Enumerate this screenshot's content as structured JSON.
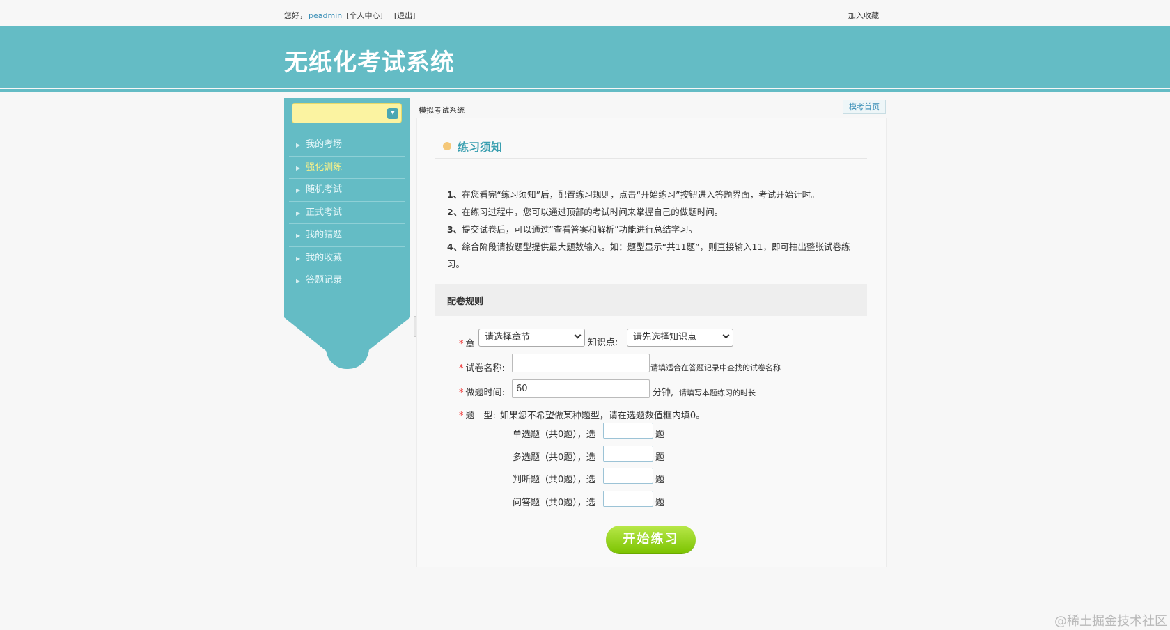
{
  "topbar": {
    "greeting": "您好，",
    "username": "peadmin",
    "profile_link": "[个人中心]",
    "logout_link": "[退出]",
    "bookmark": "加入收藏"
  },
  "header": {
    "title": "无纸化考试系统"
  },
  "sidebar": {
    "select_value": "",
    "items": [
      {
        "label": "我的考场",
        "active": false
      },
      {
        "label": "强化训练",
        "active": true
      },
      {
        "label": "随机考试",
        "active": false
      },
      {
        "label": "正式考试",
        "active": false
      },
      {
        "label": "我的错题",
        "active": false
      },
      {
        "label": "我的收藏",
        "active": false
      },
      {
        "label": "答题记录",
        "active": false
      }
    ]
  },
  "breadcrumb": "模拟考试系统",
  "home_button": "模考首页",
  "notice": {
    "title": "练习须知",
    "rules": [
      {
        "num": "1、",
        "text": "在您看完“练习须知”后，配置练习规则，点击“开始练习”按钮进入答题界面，考试开始计时。"
      },
      {
        "num": "2、",
        "text": "在练习过程中，您可以通过顶部的考试时间来掌握自己的做题时间。"
      },
      {
        "num": "3、",
        "text": "提交试卷后，可以通过“查看答案和解析”功能进行总结学习。"
      },
      {
        "num": "4、",
        "text": "综合阶段请按题型提供最大题数输入。如：题型显示“共11题”，则直接输入11，即可抽出整张试卷练习。"
      }
    ]
  },
  "config": {
    "title": "配卷规则",
    "chapter_label": "章",
    "chapter_select": "请选择章节",
    "knowledge_label": "知识点:",
    "knowledge_select": "请先选择知识点",
    "paper_name_label": "试卷名称:",
    "paper_name_value": "",
    "paper_name_hint": "请填适合在答题记录中查找的试卷名称",
    "time_label": "做题时间:",
    "time_value": "60",
    "time_unit": "分钟,",
    "time_hint": "请填写本题练习的时长",
    "type_label": "题　型:",
    "type_hint": "如果您不希望做某种题型，请在选题数值框内填0。",
    "types": [
      {
        "label": "单选题（共0题），选",
        "unit": "题",
        "value": ""
      },
      {
        "label": "多选题（共0题），选",
        "unit": "题",
        "value": ""
      },
      {
        "label": "判断题（共0题），选",
        "unit": "题",
        "value": ""
      },
      {
        "label": "问答题（共0题），选",
        "unit": "题",
        "value": ""
      }
    ]
  },
  "start_button": "开始练习",
  "watermark": "@稀土掘金技术社区",
  "colors": {
    "header": "#64bcc5",
    "accent_title": "#3a9fb0",
    "start_button": "#7cc300",
    "sidebar_select": "#fbf3a1"
  }
}
